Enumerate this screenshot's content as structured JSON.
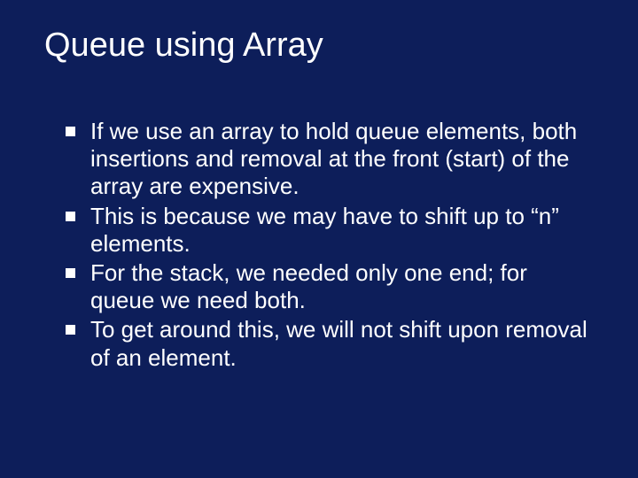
{
  "title": "Queue using Array",
  "bullets": [
    "If we use an array to hold queue elements, both insertions and removal at the front (start) of the array are expensive.",
    "This is because we may have to shift up to “n” elements.",
    "For the stack, we needed only one end; for queue we need both.",
    "To get around this, we will not shift upon removal of an element."
  ]
}
